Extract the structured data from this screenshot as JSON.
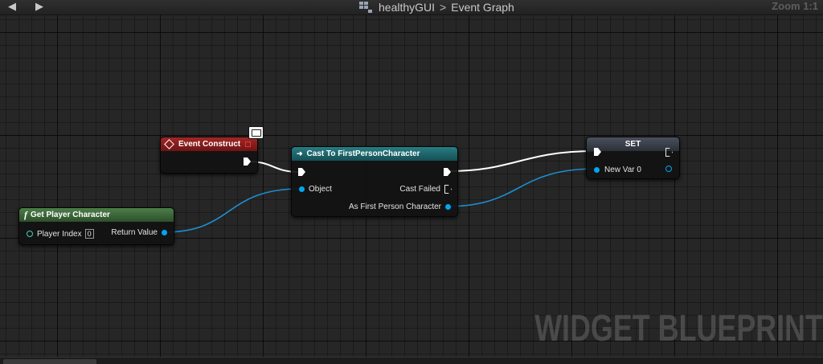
{
  "window": {
    "blueprint_name": "healthyGUI",
    "graph_name": "Event Graph",
    "zoom_label": "Zoom 1:1",
    "breadcrumb_separator": ">"
  },
  "watermark": "WIDGET BLUEPRINT",
  "colors": {
    "event_header": "#8f1c1c",
    "cast_header": "#1e6b70",
    "function_header": "#3d6b3a",
    "set_header": "#3a3f48",
    "object_pin": "#00a6f0",
    "exec_wire": "#ffffff"
  },
  "nodes": {
    "event_construct": {
      "title": "Event Construct",
      "icon": "event-diamond-icon"
    },
    "cast": {
      "title": "Cast To FirstPersonCharacter",
      "icon": "cast-arrows-icon",
      "input_object": "Object",
      "cast_failed": "Cast Failed",
      "output_as": "As First Person Character"
    },
    "get_player_character": {
      "title": "Get Player Character",
      "icon": "function-f-icon",
      "player_index_label": "Player Index",
      "player_index_value": "0",
      "return_value": "Return Value"
    },
    "set": {
      "title": "SET",
      "var_label": "New Var 0"
    }
  }
}
